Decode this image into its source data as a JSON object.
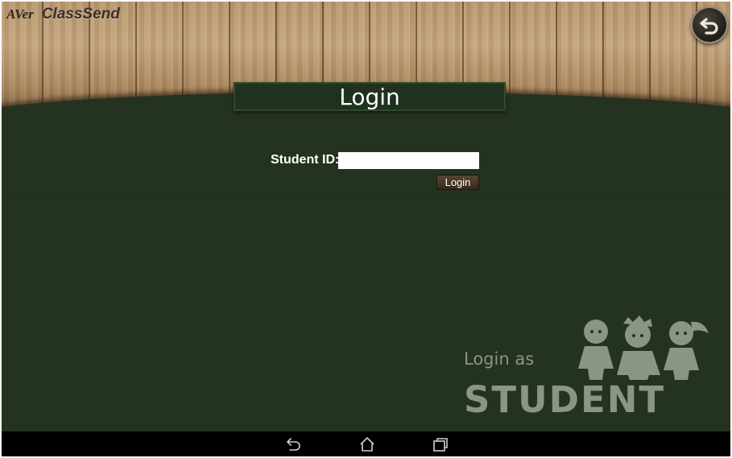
{
  "header": {
    "brand_aver": "AVer",
    "brand_name": "ClassSend",
    "title": "Login"
  },
  "form": {
    "student_id_label": "Student ID:",
    "student_id_value": "",
    "login_button": "Login"
  },
  "branding": {
    "login_as": "Login as",
    "student": "STUDENT"
  },
  "icons": {
    "back": "return-arrow-icon",
    "students": "students-illustration",
    "nav_back": "nav-back-icon",
    "nav_home": "nav-home-icon",
    "nav_recents": "nav-recents-icon"
  },
  "colors": {
    "chalkboard": "#24331f",
    "wood": "#b79770",
    "button": "#3a2a1c"
  }
}
